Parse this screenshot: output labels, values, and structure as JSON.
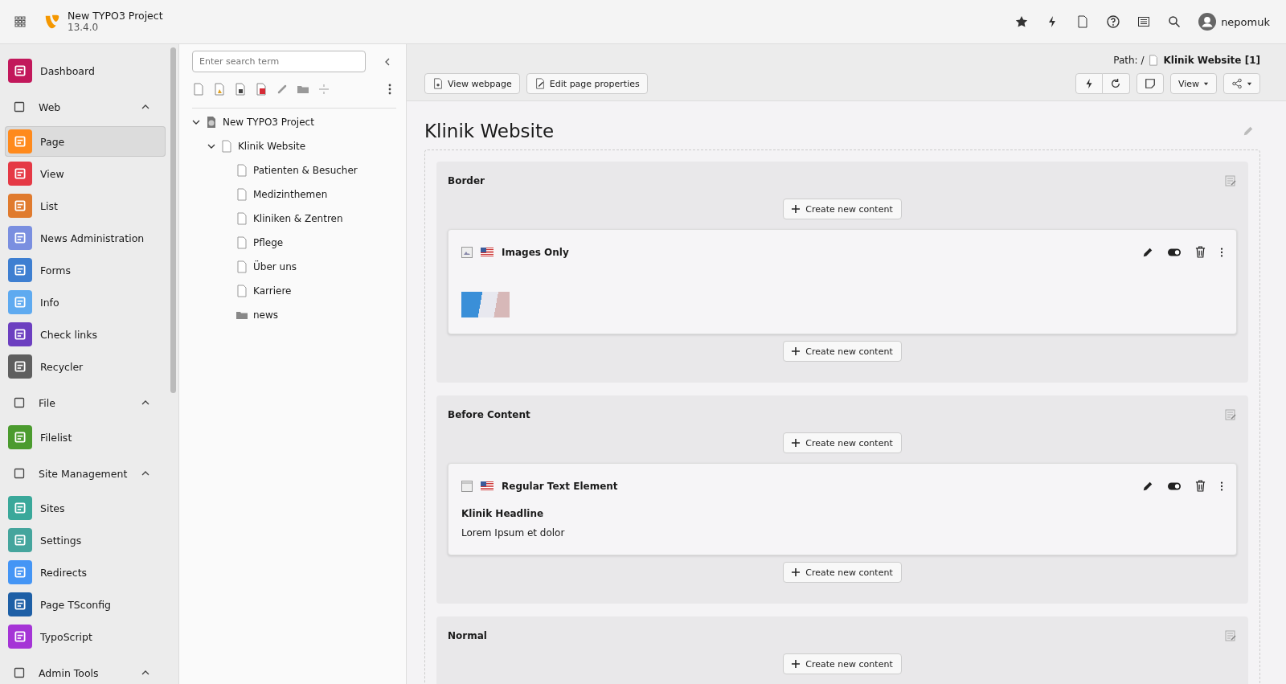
{
  "topbar": {
    "title": "New TYPO3 Project",
    "version": "13.4.0",
    "user": "nepomuk"
  },
  "sidebar": {
    "items": [
      {
        "kind": "module",
        "label": "Dashboard",
        "color": "#c2185b",
        "selected": false
      },
      {
        "kind": "group",
        "label": "Web",
        "expanded": true,
        "children": [
          {
            "label": "Page",
            "color": "#ff8a1c",
            "selected": true
          },
          {
            "label": "View",
            "color": "#e53945",
            "selected": false
          },
          {
            "label": "List",
            "color": "#e07b2e",
            "selected": false
          },
          {
            "label": "News Administration",
            "color": "#7a8fe0",
            "selected": false
          },
          {
            "label": "Forms",
            "color": "#3e7fd1",
            "selected": false
          },
          {
            "label": "Info",
            "color": "#5eaaf0",
            "selected": false
          },
          {
            "label": "Check links",
            "color": "#6c3fc0",
            "selected": false
          },
          {
            "label": "Recycler",
            "color": "#5f5f5f",
            "selected": false
          }
        ]
      },
      {
        "kind": "group",
        "label": "File",
        "expanded": true,
        "children": [
          {
            "label": "Filelist",
            "color": "#4b9b2e",
            "selected": false
          }
        ]
      },
      {
        "kind": "group",
        "label": "Site Management",
        "expanded": true,
        "children": [
          {
            "label": "Sites",
            "color": "#3aa89a",
            "selected": false
          },
          {
            "label": "Settings",
            "color": "#45a59d",
            "selected": false
          },
          {
            "label": "Redirects",
            "color": "#4495f5",
            "selected": false
          },
          {
            "label": "Page TSconfig",
            "color": "#1d5fa6",
            "selected": false
          },
          {
            "label": "TypoScript",
            "color": "#a534d6",
            "selected": false
          }
        ]
      },
      {
        "kind": "group",
        "label": "Admin Tools",
        "expanded": true
      }
    ]
  },
  "tree": {
    "search": {
      "placeholder": "Enter search term"
    },
    "nodes": [
      {
        "kind": "root",
        "label": "New TYPO3 Project",
        "expanded": true,
        "children": [
          {
            "kind": "page",
            "label": "Klinik Website",
            "expanded": true,
            "children": [
              {
                "kind": "page",
                "label": "Patienten & Besucher"
              },
              {
                "kind": "page",
                "label": "Medizinthemen"
              },
              {
                "kind": "page",
                "label": "Kliniken & Zentren"
              },
              {
                "kind": "page",
                "label": "Pflege"
              },
              {
                "kind": "page",
                "label": "Über uns"
              },
              {
                "kind": "page",
                "label": "Karriere"
              },
              {
                "kind": "folder",
                "label": "news"
              }
            ]
          }
        ]
      }
    ]
  },
  "docheader": {
    "path_label": "Path: /",
    "path_page": "Klinik Website [1]",
    "buttons": [
      "View webpage",
      "Edit page properties"
    ],
    "view_menu": "View"
  },
  "page_title": "Klinik Website",
  "sections": [
    {
      "title": "Border",
      "items": [
        {
          "kind": "create",
          "label": "Create new content"
        },
        {
          "kind": "images",
          "title": "Images Only"
        },
        {
          "kind": "create",
          "label": "Create new content"
        }
      ]
    },
    {
      "title": "Before Content",
      "items": [
        {
          "kind": "create",
          "label": "Create new content"
        },
        {
          "kind": "text",
          "title": "Regular Text Element",
          "headline": "Klinik Headline",
          "body": "Lorem Ipsum et dolor"
        },
        {
          "kind": "create",
          "label": "Create new content"
        }
      ]
    },
    {
      "title": "Normal",
      "items": [
        {
          "kind": "create",
          "label": "Create new content"
        }
      ]
    }
  ]
}
